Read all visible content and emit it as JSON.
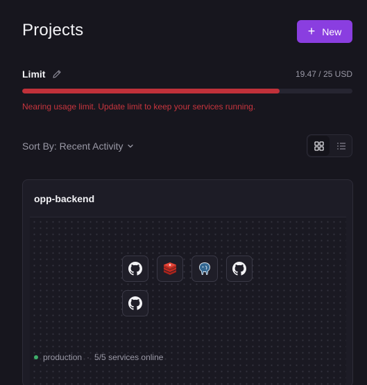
{
  "header": {
    "title": "Projects",
    "new_button_label": "New",
    "accent_color": "#8a3ee0"
  },
  "usage": {
    "label": "Limit",
    "value_text": "19.47 / 25 USD",
    "used": 19.47,
    "limit": 25,
    "fraction": 0.7788,
    "bar_color": "#c0313a",
    "warning": "Nearing usage limit. Update limit to keep your services running."
  },
  "toolbar": {
    "sort_label": "Sort By: Recent Activity",
    "view_mode": "grid"
  },
  "projects": [
    {
      "name": "opp-backend",
      "environment": "production",
      "status_text": "5/5 services online",
      "status_color": "#3fae6a",
      "services": [
        {
          "icon": "github-icon"
        },
        {
          "icon": "redis-icon"
        },
        {
          "icon": "postgres-icon"
        },
        {
          "icon": "github-icon"
        },
        {
          "icon": "github-icon"
        }
      ]
    }
  ]
}
